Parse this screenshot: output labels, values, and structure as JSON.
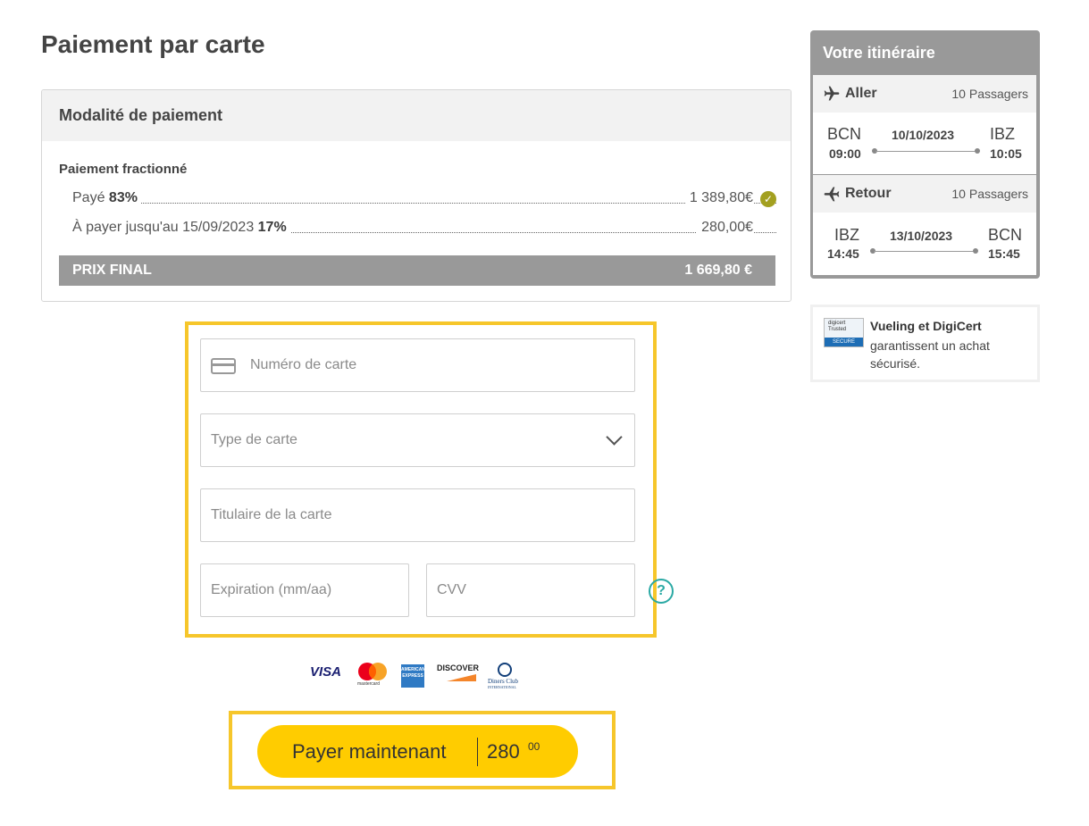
{
  "page": {
    "title": "Paiement par carte"
  },
  "modality": {
    "header": "Modalité de paiement",
    "split_title": "Paiement fractionné",
    "paid": {
      "label": "Payé ",
      "percent": "83%",
      "amount": "1 389,80€"
    },
    "due": {
      "label": "À payer jusqu'au 15/09/2023 ",
      "percent": "17%",
      "amount": "280,00€"
    },
    "final": {
      "label": "PRIX FINAL",
      "amount": "1 669,80 €"
    }
  },
  "form": {
    "card_number_placeholder": "Numéro de carte",
    "card_type_placeholder": "Type de carte",
    "holder_placeholder": "Titulaire de la carte",
    "expiry_placeholder": "Expiration (mm/aa)",
    "cvv_placeholder": "CVV",
    "help": "?"
  },
  "brands": {
    "visa": "VISA",
    "mastercard": "mastercard",
    "amex": "AMERICAN EXPRESS",
    "discover": "DISCOVER",
    "diners": "Diners Club",
    "diners_sub": "INTERNATIONAL"
  },
  "pay_button": {
    "label": "Payer maintenant",
    "amount": "280",
    "cents": "00"
  },
  "itinerary": {
    "title": "Votre itinéraire",
    "segments": [
      {
        "name": "Aller",
        "passengers": "10 Passagers",
        "from": "BCN",
        "dep": "09:00",
        "date": "10/10/2023",
        "to": "IBZ",
        "arr": "10:05"
      },
      {
        "name": "Retour",
        "passengers": "10 Passagers",
        "from": "IBZ",
        "dep": "14:45",
        "date": "13/10/2023",
        "to": "BCN",
        "arr": "15:45"
      }
    ]
  },
  "security": {
    "badge_top": "digicert Trusted",
    "badge_bottom": "SECURE",
    "title": "Vueling et DigiCert",
    "text": "garantissent un achat sécurisé."
  }
}
